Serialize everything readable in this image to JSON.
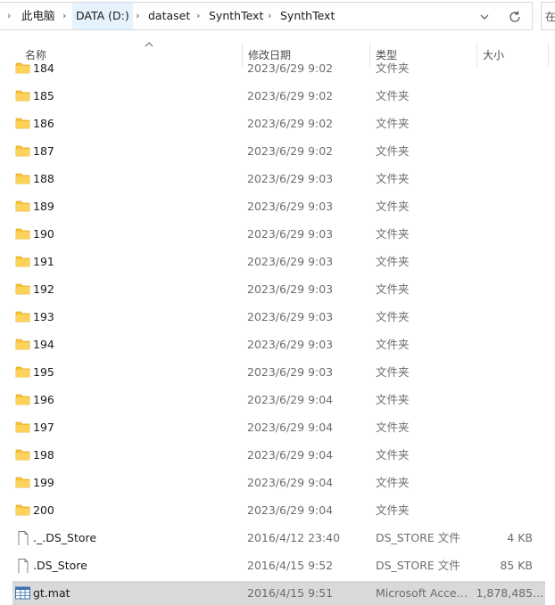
{
  "breadcrumb": {
    "items": [
      "此电脑",
      "DATA (D:)",
      "dataset",
      "SynthText",
      "SynthText"
    ]
  },
  "search": {
    "partial_glyph": "在"
  },
  "columns": {
    "name": "名称",
    "date": "修改日期",
    "type": "类型",
    "size": "大小"
  },
  "rows": [
    {
      "name": "184",
      "date": "2023/6/29 9:02",
      "type": "文件夹",
      "size": "",
      "kind": "folder"
    },
    {
      "name": "185",
      "date": "2023/6/29 9:02",
      "type": "文件夹",
      "size": "",
      "kind": "folder"
    },
    {
      "name": "186",
      "date": "2023/6/29 9:02",
      "type": "文件夹",
      "size": "",
      "kind": "folder"
    },
    {
      "name": "187",
      "date": "2023/6/29 9:02",
      "type": "文件夹",
      "size": "",
      "kind": "folder"
    },
    {
      "name": "188",
      "date": "2023/6/29 9:03",
      "type": "文件夹",
      "size": "",
      "kind": "folder"
    },
    {
      "name": "189",
      "date": "2023/6/29 9:03",
      "type": "文件夹",
      "size": "",
      "kind": "folder"
    },
    {
      "name": "190",
      "date": "2023/6/29 9:03",
      "type": "文件夹",
      "size": "",
      "kind": "folder"
    },
    {
      "name": "191",
      "date": "2023/6/29 9:03",
      "type": "文件夹",
      "size": "",
      "kind": "folder"
    },
    {
      "name": "192",
      "date": "2023/6/29 9:03",
      "type": "文件夹",
      "size": "",
      "kind": "folder"
    },
    {
      "name": "193",
      "date": "2023/6/29 9:03",
      "type": "文件夹",
      "size": "",
      "kind": "folder"
    },
    {
      "name": "194",
      "date": "2023/6/29 9:03",
      "type": "文件夹",
      "size": "",
      "kind": "folder"
    },
    {
      "name": "195",
      "date": "2023/6/29 9:03",
      "type": "文件夹",
      "size": "",
      "kind": "folder"
    },
    {
      "name": "196",
      "date": "2023/6/29 9:04",
      "type": "文件夹",
      "size": "",
      "kind": "folder"
    },
    {
      "name": "197",
      "date": "2023/6/29 9:04",
      "type": "文件夹",
      "size": "",
      "kind": "folder"
    },
    {
      "name": "198",
      "date": "2023/6/29 9:04",
      "type": "文件夹",
      "size": "",
      "kind": "folder"
    },
    {
      "name": "199",
      "date": "2023/6/29 9:04",
      "type": "文件夹",
      "size": "",
      "kind": "folder"
    },
    {
      "name": "200",
      "date": "2023/6/29 9:04",
      "type": "文件夹",
      "size": "",
      "kind": "folder"
    },
    {
      "name": "._.DS_Store",
      "date": "2016/4/12 23:40",
      "type": "DS_STORE 文件",
      "size": "4 KB",
      "kind": "file"
    },
    {
      "name": ".DS_Store",
      "date": "2016/4/15 9:52",
      "type": "DS_STORE 文件",
      "size": "85 KB",
      "kind": "file"
    },
    {
      "name": "gt.mat",
      "date": "2016/4/15 9:51",
      "type": "Microsoft Access Table Shortcut",
      "size": "1,878,485...",
      "kind": "table",
      "selected": true
    }
  ],
  "colors": {
    "folder": "#f8c33a",
    "folder_dark": "#e4a81e",
    "selected_bg": "#d9d9d9",
    "hover_bg": "#e5f3ff"
  },
  "icons": {
    "folder": "folder-icon",
    "file": "file-icon",
    "table": "table-icon",
    "chevron": "chevron-right-icon",
    "dropdown": "chevron-down-icon",
    "refresh": "refresh-icon",
    "sort": "sort-up-icon"
  }
}
